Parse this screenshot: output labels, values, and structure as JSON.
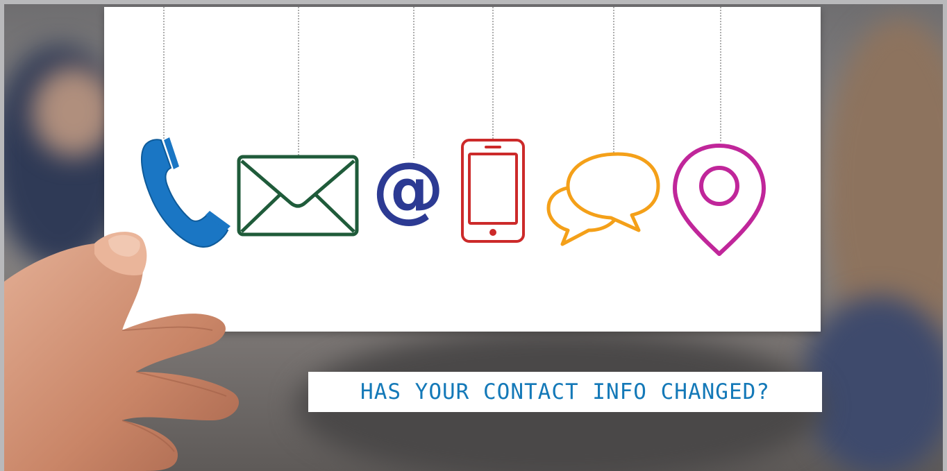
{
  "headline": "HAS YOUR CONTACT INFO CHANGED?",
  "colors": {
    "phone": "#1a76c4",
    "email": "#1f5b3a",
    "at_sign": "#2c3a93",
    "mobile": "#cc2a2a",
    "chat": "#f4a019",
    "location": "#c0269a",
    "headline_text": "#1479b8"
  },
  "icons": [
    "phone-icon",
    "envelope-icon",
    "at-sign-icon",
    "mobile-phone-icon",
    "chat-bubbles-icon",
    "location-pin-icon"
  ]
}
